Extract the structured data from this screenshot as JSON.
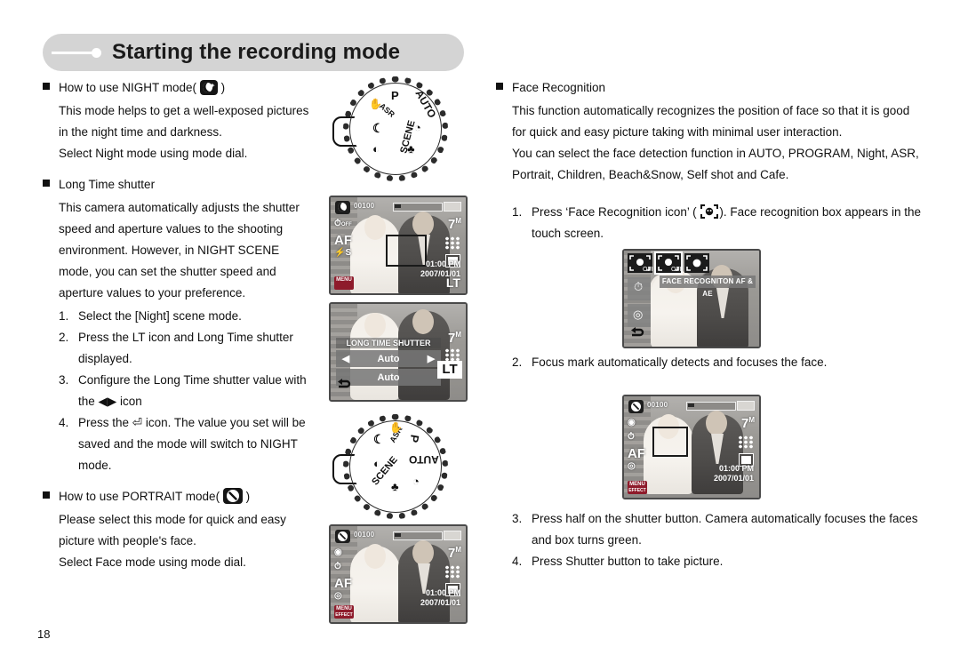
{
  "header": {
    "title": "Starting the recording mode"
  },
  "page_number": "18",
  "left_column": {
    "night_heading": "How to use NIGHT mode(",
    "night_heading_close": ")",
    "night_icon": "night-mode-icon",
    "night_paragraph": [
      "This mode helps to get a well-exposed pictures",
      "in the night time and darkness.",
      "Select Night mode using mode dial."
    ],
    "longtime_heading": "Long Time shutter",
    "longtime_paragraph": [
      "This camera automatically adjusts the shutter",
      "speed and aperture values to the shooting",
      "environment. However, in NIGHT SCENE",
      "mode, you can set the shutter speed and",
      "aperture values to your preference."
    ],
    "steps": [
      {
        "num": "1.",
        "lines": [
          "Select the [Night] scene mode."
        ]
      },
      {
        "num": "2.",
        "lines": [
          "Press the LT icon and Long Time shutter",
          "displayed."
        ]
      },
      {
        "num": "3.",
        "lines": [
          "Configure the Long Time shutter value with",
          "the ◀▶ icon"
        ]
      },
      {
        "num": "4.",
        "lines": [
          "Press the ⏎ icon. The value you set will be",
          "saved and the mode will switch to NIGHT",
          "mode."
        ]
      }
    ],
    "portrait_heading": "How to use PORTRAIT mode(",
    "portrait_heading_close": ")",
    "portrait_icon": "portrait-mode-icon",
    "portrait_paragraph": [
      "Please select this mode for quick and easy",
      "picture with people's face.",
      "Select Face mode using mode dial."
    ]
  },
  "right_column": {
    "face_heading": "Face Recognition",
    "face_paragraph": [
      "This function automatically recognizes the position of face so that it is good",
      "for quick and easy picture taking with minimal user interaction.",
      "You can select the face detection function in AUTO, PROGRAM, Night, ASR,",
      "Portrait, Children, Beach&Snow, Self shot and Cafe."
    ],
    "steps": [
      {
        "num": "1.",
        "prefix": "Press ‘Face Recognition icon’ (",
        "icon": "face-recognition-icon",
        "suffix": "). Face recognition box appears in the",
        "lines2": [
          "touch screen."
        ]
      },
      {
        "num": "2.",
        "lines": [
          "Focus mark automatically detects and focuses the face."
        ]
      },
      {
        "num": "3.",
        "lines": [
          "Press half on the shutter button. Camera automatically focuses the faces",
          "and box turns green."
        ]
      },
      {
        "num": "4.",
        "lines": [
          "Press Shutter button to take picture."
        ]
      }
    ]
  },
  "mode_dial_night": {
    "name": "mode-dial-night",
    "markers": [
      "P",
      "AUTO",
      "ASR",
      "SCENE"
    ],
    "highlighted": "NIGHT"
  },
  "mode_dial_portrait": {
    "name": "mode-dial-portrait",
    "markers": [
      "P",
      "AUTO",
      "ASR",
      "SCENE"
    ],
    "highlighted": "PORTRAIT"
  },
  "lcd_night": {
    "counter": "00100",
    "resolution": "7",
    "resolution_unit": "M",
    "self_timer": "OFF",
    "af": "AF",
    "flash": "⚡S",
    "time": "01:00 PM",
    "date": "2007/01/01",
    "menu": "MENU",
    "lt": "LT"
  },
  "lcd_longtime": {
    "title": "LONG TIME SHUTTER",
    "value_top": "Auto",
    "value_bottom": "Auto",
    "arrow_left": "◀",
    "arrow_right": "▶",
    "resolution": "7",
    "resolution_unit": "M",
    "lt": "LT"
  },
  "lcd_portrait": {
    "counter": "00100",
    "resolution": "7",
    "resolution_unit": "M",
    "af": "AF",
    "time": "01:00 PM",
    "date": "2007/01/01",
    "menu": "MENU",
    "menu_sub": "EFFECT"
  },
  "lcd_face_menu": {
    "label": "FACE RECOGNITON AF & AE",
    "options": [
      "face-off",
      "face-off-selected",
      "face-on"
    ]
  },
  "lcd_face_detect": {
    "counter": "00100",
    "resolution": "7",
    "resolution_unit": "M",
    "af": "AF",
    "time": "01:00 PM",
    "date": "2007/01/01",
    "menu": "MENU",
    "menu_sub": "EFFECT"
  },
  "colors": {
    "banner_bg": "#d4d4d4",
    "text": "#101010",
    "lcd_frame": "#4a4a4a",
    "menu_red": "#8e1b2b"
  }
}
